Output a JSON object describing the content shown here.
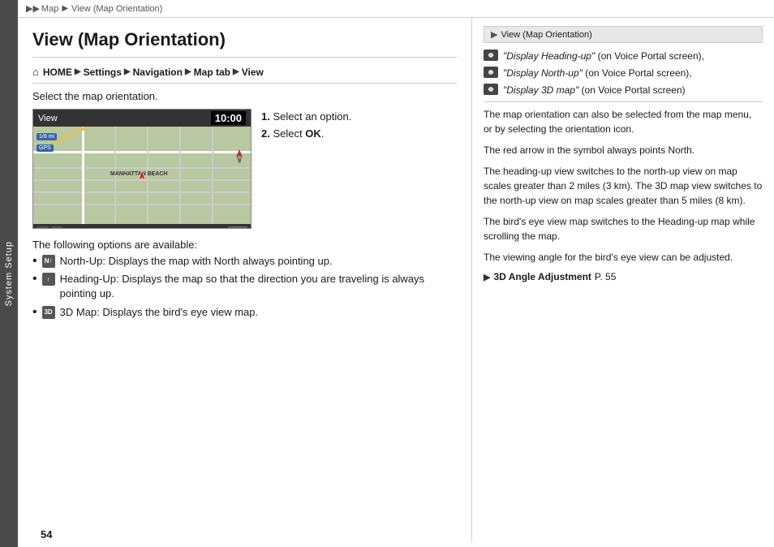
{
  "breadcrumb": {
    "items": [
      "Map",
      "View (Map Orientation)"
    ]
  },
  "sidebar": {
    "label": "System Setup"
  },
  "page": {
    "title": "View (Map Orientation)",
    "nav_home": "HOME",
    "nav_items": [
      "Settings",
      "Navigation",
      "Map tab",
      "View"
    ],
    "select_text": "Select the map orientation.",
    "map": {
      "header_label": "View",
      "time": "10:00",
      "location_label": "MANHATTAN BEACH",
      "gps_label": "GPS",
      "ok_label": "OK",
      "scale_label": "1/8 mi"
    },
    "instructions": {
      "step1": "1.",
      "step1_text": "Select an option.",
      "step2": "2.",
      "step2_text": "Select ",
      "step2_bold": "OK",
      "step2_end": "."
    },
    "options_intro": "The following options are available:",
    "bullets": [
      {
        "icon": "N↑",
        "text": "North-Up: Displays the map with North always pointing up."
      },
      {
        "icon": "↑",
        "text": "Heading-Up: Displays the map so that the direction you are traveling is always pointing up."
      },
      {
        "icon": "3D",
        "text": "3D Map: Displays the bird's eye view map."
      }
    ]
  },
  "right_panel": {
    "header": "View (Map Orientation)",
    "voice_items": [
      {
        "quoted": "\"Display Heading-up\"",
        "suffix": " (on Voice Portal screen),"
      },
      {
        "quoted": "\"Display North-up\"",
        "suffix": " (on Voice Portal screen),"
      },
      {
        "quoted": "\"Display 3D map\"",
        "suffix": " (on Voice Portal screen)"
      }
    ],
    "paragraph1": "The map orientation can also be selected from the map menu, or by selecting the orientation icon.",
    "paragraph2": "The red arrow in the symbol always points North.",
    "paragraph3": "The heading-up view switches to the north-up view on map scales greater than 2 miles (3 km). The 3D map view switches to the north-up view on map scales greater than 5 miles (8 km).",
    "paragraph4": "The bird's eye view map switches to the Heading-up map while scrolling the map.",
    "paragraph5": "The viewing angle for the bird's eye view can be adjusted.",
    "link_text": "3D Angle Adjustment",
    "link_page": "P. 55"
  },
  "page_number": "54"
}
